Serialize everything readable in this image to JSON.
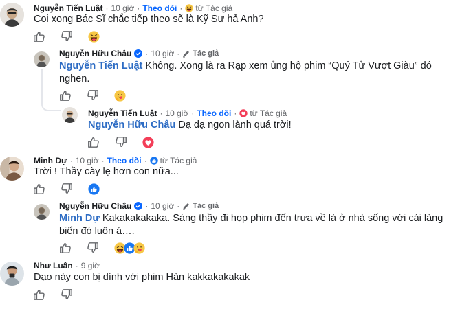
{
  "comments": [
    {
      "author": "Nguyễn Tiến Luật",
      "time": "10 giờ",
      "follow": "Theo dõi",
      "badge": "từ Tác giả",
      "badge_icon": "laugh-icon",
      "text": "Coi xong Bác Sĩ chắc tiếp theo sẽ là Kỹ Sư hả Anh?",
      "reactions": [
        "haha"
      ]
    },
    {
      "author": "Nguyễn Hữu Châu",
      "verified": true,
      "time": "10 giờ",
      "author_tag": "Tác giả",
      "mention": "Nguyễn Tiến Luật",
      "text": "Không. Xong là ra Rạp xem ủng hộ phim “Quý Tử Vượt Giàu” đó nghen.",
      "reactions": [
        "care"
      ]
    },
    {
      "author": "Nguyễn Tiến Luật",
      "time": "10 giờ",
      "follow": "Theo dõi",
      "badge": "từ Tác giả",
      "badge_icon": "heart-icon",
      "mention": "Nguyễn Hữu Châu",
      "text": "Dạ dạ ngon lành quá trời!",
      "reactions": [
        "love"
      ]
    },
    {
      "author": "Minh Dự",
      "time": "10 giờ",
      "follow": "Theo dõi",
      "badge": "từ Tác giả",
      "badge_icon": "like-icon",
      "text": "Trời ! Thầy cày lẹ hơn con nữa...",
      "reactions": [
        "like"
      ]
    },
    {
      "author": "Nguyễn Hữu Châu",
      "verified": true,
      "time": "10 giờ",
      "author_tag": "Tác giả",
      "mention": "Minh Dự",
      "text": "Kakakakakaka. Sáng thầy đi họp phim đến trưa về là ở nhà sống với cái làng biến đó luôn á….",
      "reactions": [
        "haha",
        "like",
        "care"
      ]
    },
    {
      "author": "Như Luân",
      "time": "9 giờ",
      "text": "Dạo này con bị dính với phim Hàn kakkakakakak",
      "reactions": []
    }
  ],
  "colors": {
    "accent": "#0866ff",
    "mention": "#2d6cc4",
    "muted": "#65676b",
    "text": "#1c1e21"
  }
}
